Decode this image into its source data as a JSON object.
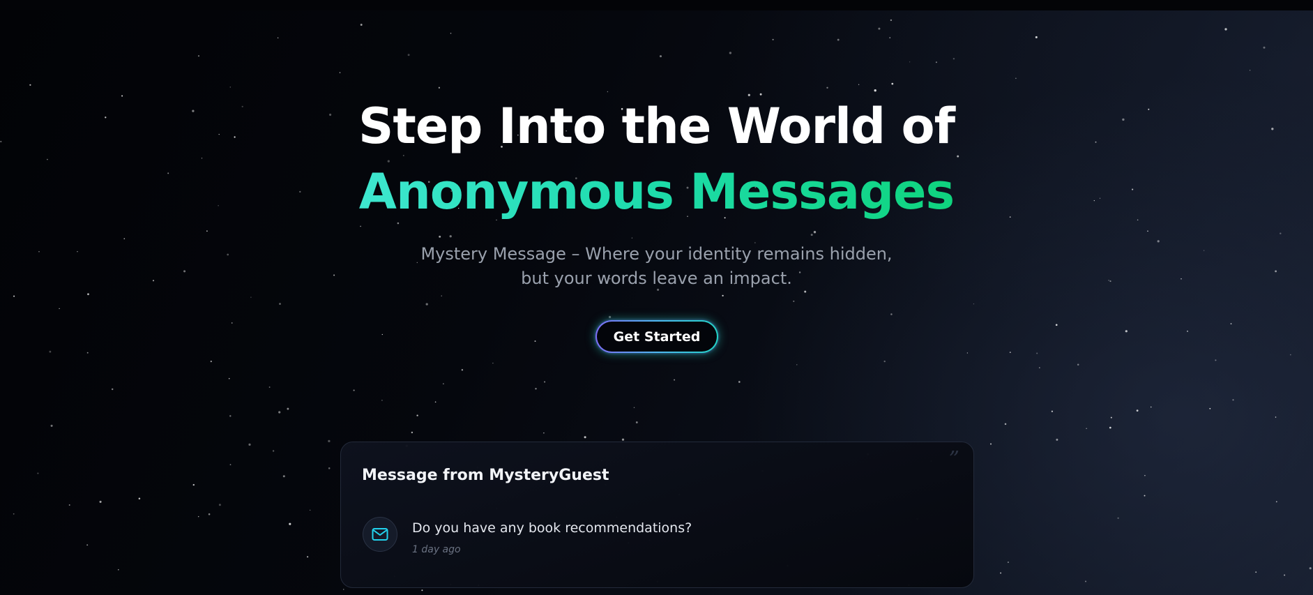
{
  "hero": {
    "headline_line1": "Step Into the World of",
    "headline_line2": "Anonymous Messages",
    "subtitle": "Mystery Message – Where your identity remains hidden, but your words leave an impact.",
    "cta_label": "Get Started"
  },
  "message_card": {
    "title": "Message from MysteryGuest",
    "quote_mark": "”",
    "message": "Do you have any book recommendations?",
    "time": "1 day ago",
    "icon": "mail-icon"
  },
  "colors": {
    "background": "#05070c",
    "headline": "#ffffff",
    "gradient_start": "#3ee7cf",
    "gradient_end": "#0fd47e",
    "subtitle": "#9aa1ad",
    "icon_accent": "#22d3ee"
  }
}
